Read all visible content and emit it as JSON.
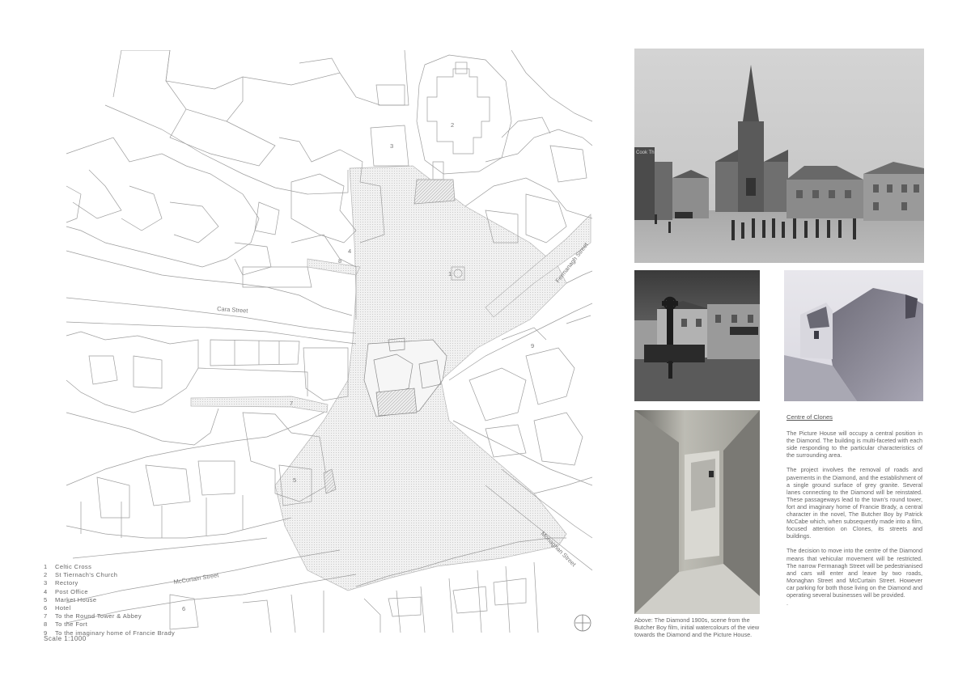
{
  "legend": {
    "items": [
      {
        "num": "1",
        "label": "Celtic Cross"
      },
      {
        "num": "2",
        "label": "St Tiernach's Church"
      },
      {
        "num": "3",
        "label": "Rectory"
      },
      {
        "num": "4",
        "label": "Post Office"
      },
      {
        "num": "5",
        "label": "Market House"
      },
      {
        "num": "6",
        "label": "Hotel"
      },
      {
        "num": "7",
        "label": "To the Round Tower & Abbey"
      },
      {
        "num": "8",
        "label": "To the Fort"
      },
      {
        "num": "9",
        "label": "To the imaginary home of Francie Brady"
      }
    ],
    "scale": "Scale 1:1000"
  },
  "map_labels": {
    "cara_street": "Cara Street",
    "fermanagh_street": "Fermanagh Street",
    "mccurtain_street": "McCurtain Street",
    "monaghan_street": "Monaghan Street",
    "n1": "1",
    "n2": "2",
    "n3": "3",
    "n4": "4",
    "n5": "5",
    "n6": "6",
    "n7": "7",
    "n8": "8",
    "n9": "9"
  },
  "photos": {
    "main_sign": "Cook Th"
  },
  "caption": "Above: The Diamond 1900s, scene from the Butcher Boy film, initial watercolours of the view towards the Diamond and the Picture House.",
  "description": {
    "heading": "Centre of Clones",
    "p1": "The Picture House will occupy a central position in the Diamond. The building is multi-faceted with each side responding to the particular characteristics of the surrounding area.",
    "p2": "The project involves the removal of roads and pavements in the Diamond, and the establishment of a single ground surface of grey granite. Several lanes connecting to the Diamond will be reinstated. These passageways lead to the town's round tower, fort and imaginary home of Francie Brady, a central character in the novel, The Butcher Boy by Patrick McCabe which, when subsequently made into a film, focused attention on Clones, its streets and buildings.",
    "p3": "The decision to move into the centre of the Diamond means that vehicular movement will be restricted. The narrow Fermanagh Street will be pedestrianised and cars will enter and leave by two roads, Monaghan Street and McCurtain Street. However car parking for both those living on the Diamond and operating several businesses will be provided.",
    "p4": "."
  },
  "colors": {
    "map_line": "#9a9a9a",
    "paving": "#e6e6e6",
    "paper": "#ffffff"
  }
}
